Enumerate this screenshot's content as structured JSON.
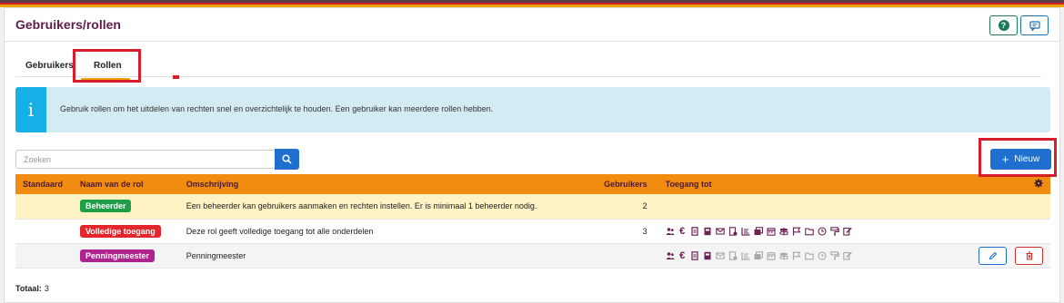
{
  "page": {
    "title": "Gebruikers/rollen"
  },
  "tabs": [
    {
      "label": "Gebruikers"
    },
    {
      "label": "Rollen"
    }
  ],
  "info": {
    "text": "Gebruik rollen om het uitdelen van rechten snel en overzichtelijk te houden. Een gebruiker kan meerdere rollen hebben."
  },
  "search": {
    "placeholder": "Zoeken"
  },
  "new_button": {
    "label": "Nieuw"
  },
  "table": {
    "headers": {
      "default": "Standaard",
      "name": "Naam van de rol",
      "description": "Omschrijving",
      "users": "Gebruikers",
      "access": "Toegang tot"
    },
    "rows": [
      {
        "name": "Beheerder",
        "color": "#1f9e4a",
        "description": "Een beheerder kan gebruikers aanmaken en rechten instellen. Er is minimaal 1 beheerder nodig.",
        "users": "2"
      },
      {
        "name": "Volledige toegang",
        "color": "#e3262b",
        "description": "Deze rol geeft volledige toegang tot alle onderdelen",
        "users": "3"
      },
      {
        "name": "Penningmeester",
        "color": "#b0238f",
        "description": "Penningmeester",
        "users": ""
      }
    ]
  },
  "footer": {
    "total_label": "Totaal:",
    "total_value": "3"
  },
  "colors": {
    "brand": "#5c1e46",
    "header_orange": "#f18c10",
    "primary": "#1e6fd0",
    "highlight": "#d81e2a"
  }
}
